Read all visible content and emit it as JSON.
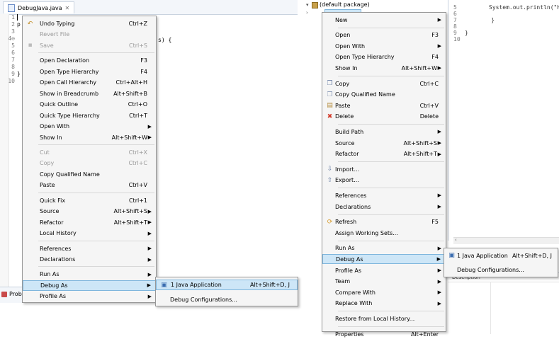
{
  "left": {
    "tab_title": "DebugJava.java",
    "line_numbers": [
      "1",
      "2",
      "3",
      "4⊖",
      "5",
      "6",
      "7",
      "8",
      "9",
      "10"
    ],
    "code_lines": [
      "p",
      "",
      "",
      "",
      "",
      "",
      "",
      "}",
      "",
      ""
    ],
    "code_fragment": "s) {",
    "bottom_tab": "Prob",
    "menu": [
      {
        "label": "Undo Typing",
        "shortcut": "Ctrl+Z",
        "icon": "undo-icon"
      },
      {
        "label": "Revert File",
        "shortcut": "",
        "disabled": true
      },
      {
        "label": "Save",
        "shortcut": "Ctrl+S",
        "disabled": true,
        "icon": "save-icon"
      },
      {
        "label": "Open Declaration",
        "shortcut": "F3"
      },
      {
        "label": "Open Type Hierarchy",
        "shortcut": "F4"
      },
      {
        "label": "Open Call Hierarchy",
        "shortcut": "Ctrl+Alt+H"
      },
      {
        "label": "Show in Breadcrumb",
        "shortcut": "Alt+Shift+B"
      },
      {
        "label": "Quick Outline",
        "shortcut": "Ctrl+O"
      },
      {
        "label": "Quick Type Hierarchy",
        "shortcut": "Ctrl+T"
      },
      {
        "label": "Open With",
        "submenu": true
      },
      {
        "label": "Show In",
        "shortcut": "Alt+Shift+W",
        "submenu": true
      },
      {
        "label": "Cut",
        "shortcut": "Ctrl+X",
        "disabled": true
      },
      {
        "label": "Copy",
        "shortcut": "Ctrl+C",
        "disabled": true
      },
      {
        "label": "Copy Qualified Name",
        "shortcut": ""
      },
      {
        "label": "Paste",
        "shortcut": "Ctrl+V"
      },
      {
        "label": "Quick Fix",
        "shortcut": "Ctrl+1"
      },
      {
        "label": "Source",
        "shortcut": "Alt+Shift+S",
        "submenu": true
      },
      {
        "label": "Refactor",
        "shortcut": "Alt+Shift+T",
        "submenu": true
      },
      {
        "label": "Local History",
        "submenu": true
      },
      {
        "label": "References",
        "submenu": true
      },
      {
        "label": "Declarations",
        "submenu": true
      },
      {
        "label": "Run As",
        "submenu": true
      },
      {
        "label": "Debug As",
        "submenu": true,
        "selected": true
      },
      {
        "label": "Profile As",
        "submenu": true
      }
    ],
    "submenu": [
      {
        "label": "1 Java Application",
        "shortcut": "Alt+Shift+D, J",
        "selected": true,
        "icon": "java-app-icon"
      },
      {
        "label": "Debug Configurations...",
        "shortcut": ""
      }
    ]
  },
  "right": {
    "tree_label": "(default package)",
    "line_numbers": [
      "5",
      "6",
      "7",
      "8",
      "9",
      "10"
    ],
    "code_lines": [
      "System.out.println(\"Hello",
      "",
      "    }",
      "",
      "}",
      ""
    ],
    "props_label": "Description",
    "menu": [
      {
        "label": "New",
        "submenu": true
      },
      {
        "label": "Open",
        "shortcut": "F3"
      },
      {
        "label": "Open With",
        "submenu": true
      },
      {
        "label": "Open Type Hierarchy",
        "shortcut": "F4"
      },
      {
        "label": "Show In",
        "shortcut": "Alt+Shift+W",
        "submenu": true
      },
      {
        "label": "Copy",
        "shortcut": "Ctrl+C",
        "icon": "copy-icon"
      },
      {
        "label": "Copy Qualified Name",
        "shortcut": "",
        "icon": "copy-qualified-icon"
      },
      {
        "label": "Paste",
        "shortcut": "Ctrl+V",
        "icon": "paste-icon"
      },
      {
        "label": "Delete",
        "shortcut": "Delete",
        "icon": "delete-icon"
      },
      {
        "label": "Build Path",
        "submenu": true
      },
      {
        "label": "Source",
        "shortcut": "Alt+Shift+S",
        "submenu": true
      },
      {
        "label": "Refactor",
        "shortcut": "Alt+Shift+T",
        "submenu": true
      },
      {
        "label": "Import...",
        "shortcut": "",
        "icon": "import-icon"
      },
      {
        "label": "Export...",
        "shortcut": "",
        "icon": "export-icon"
      },
      {
        "label": "References",
        "submenu": true
      },
      {
        "label": "Declarations",
        "submenu": true
      },
      {
        "label": "Refresh",
        "shortcut": "F5",
        "icon": "refresh-icon"
      },
      {
        "label": "Assign Working Sets...",
        "shortcut": ""
      },
      {
        "label": "Run As",
        "submenu": true
      },
      {
        "label": "Debug As",
        "submenu": true,
        "selected": true
      },
      {
        "label": "Profile As",
        "submenu": true
      },
      {
        "label": "Team",
        "submenu": true
      },
      {
        "label": "Compare With",
        "submenu": true
      },
      {
        "label": "Replace With",
        "submenu": true
      },
      {
        "label": "Restore from Local History...",
        "shortcut": ""
      },
      {
        "label": "Properties",
        "shortcut": "Alt+Enter"
      }
    ],
    "submenu": [
      {
        "label": "1 Java Application",
        "shortcut": "Alt+Shift+D, J",
        "icon": "java-app-icon"
      },
      {
        "label": "Debug Configurations...",
        "shortcut": ""
      }
    ]
  },
  "colors": {
    "selection_bg": "#cde6f7",
    "selection_border": "#7fb6dd",
    "menu_bg": "#f5f5f5",
    "disabled": "#9a9a9a"
  }
}
